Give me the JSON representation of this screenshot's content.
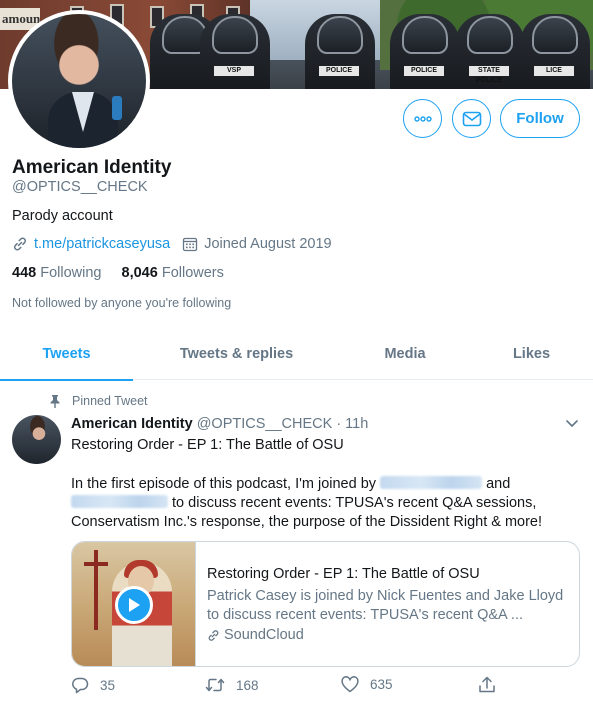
{
  "banner": {
    "sign_text": "amount",
    "badges": [
      "VSP",
      "POLICE",
      "POLICE",
      "POLICE",
      "STATE POLICE",
      "LICE"
    ]
  },
  "profile": {
    "name": "American Identity",
    "handle": "@OPTICS__CHECK",
    "bio": "Parody account",
    "link": "t.me/patrickcaseyusa",
    "joined": "Joined August 2019",
    "following_count": "448",
    "following_label": "Following",
    "followers_count": "8,046",
    "followers_label": "Followers",
    "not_followed": "Not followed by anyone you're following"
  },
  "buttons": {
    "more_icon": "more-icon",
    "message_icon": "envelope-icon",
    "follow_label": "Follow"
  },
  "tabs": [
    {
      "label": "Tweets",
      "active": true
    },
    {
      "label": "Tweets & replies",
      "active": false
    },
    {
      "label": "Media",
      "active": false
    },
    {
      "label": "Likes",
      "active": false
    }
  ],
  "tweet": {
    "pinned_label": "Pinned Tweet",
    "author_name": "American Identity",
    "author_handle": "@OPTICS__CHECK",
    "time": "· 11h",
    "title": "Restoring Order - EP 1: The Battle of OSU",
    "body_part1": "In the first episode of this podcast, I'm joined by",
    "body_part2": "and",
    "body_part3": "to discuss recent events: TPUSA's recent Q&A sessions, Conservatism Inc.'s response, the purpose of the Dissident Right & more!",
    "card": {
      "title": "Restoring Order - EP 1: The Battle of OSU",
      "description": "Patrick Casey is joined by Nick Fuentes and Jake Lloyd to discuss recent events: TPUSA's recent Q&A ...",
      "source": "SoundCloud"
    },
    "replies": "35",
    "retweets": "168",
    "likes": "635"
  },
  "colors": {
    "accent": "#1da1f2",
    "text": "#14171a",
    "secondary": "#657786",
    "border": "#e6ecf0"
  }
}
